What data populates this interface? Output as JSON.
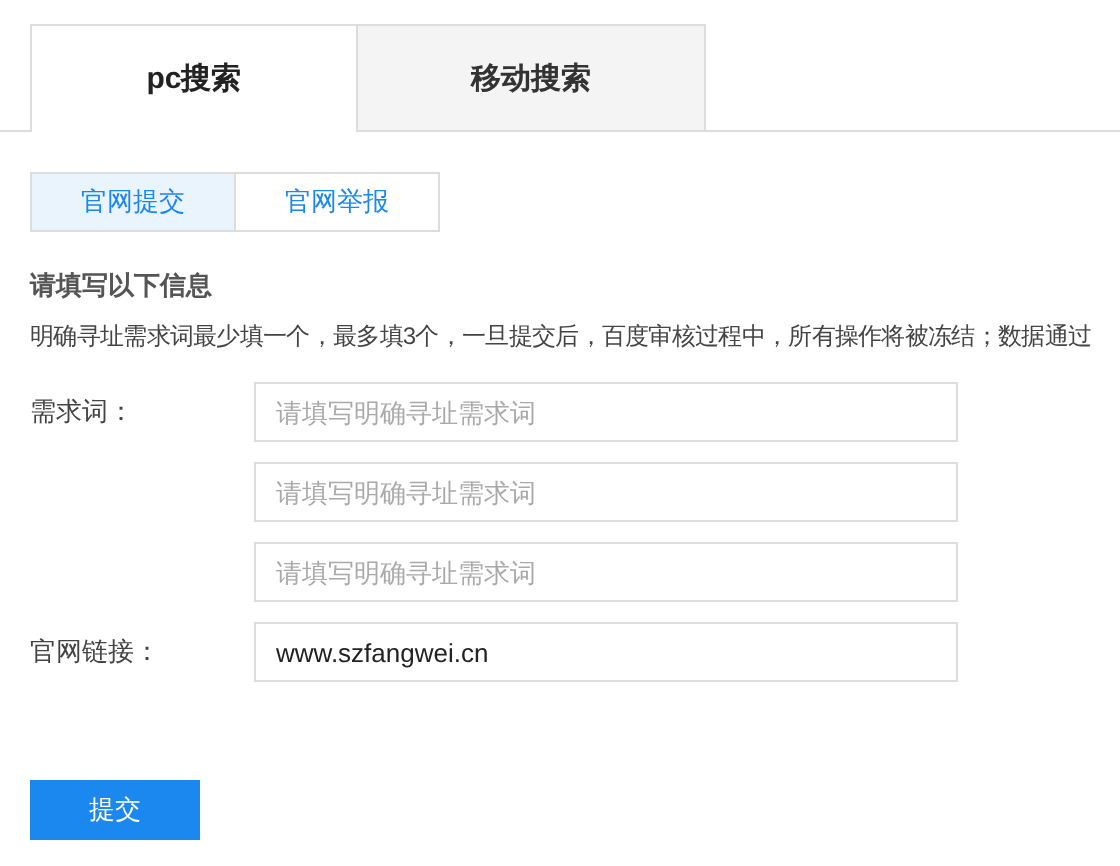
{
  "tabs": [
    {
      "label": "pc搜索",
      "selected": true
    },
    {
      "label": "移动搜索",
      "selected": false
    }
  ],
  "subtabs": [
    {
      "label": "官网提交",
      "selected": true
    },
    {
      "label": "官网举报",
      "selected": false
    }
  ],
  "heading": "请填写以下信息",
  "description": "明确寻址需求词最少填一个，最多填3个，一旦提交后，百度审核过程中，所有操作将被冻结；数据通过",
  "fields": [
    {
      "label": "需求词：",
      "placeholder": "请填写明确寻址需求词"
    },
    {
      "placeholder": "请填写明确寻址需求词"
    },
    {
      "placeholder": "请填写明确寻址需求词"
    },
    {
      "label": "官网链接：",
      "value": "www.szfangwei.cn"
    }
  ],
  "submit": "提交"
}
